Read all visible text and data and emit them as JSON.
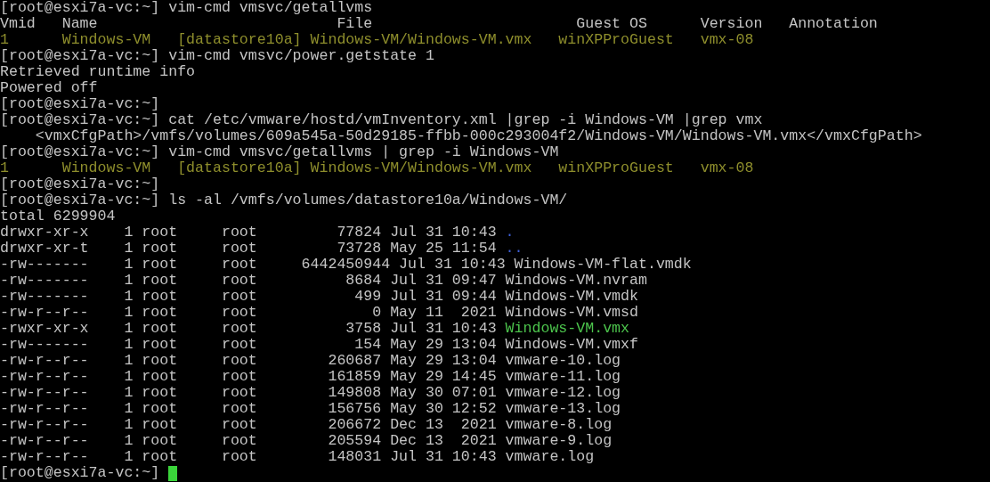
{
  "terminal": {
    "lines": [
      {
        "segments": [
          {
            "text": "[root@esxi7a-vc:~] vim-cmd vmsvc/getallvms",
            "kind": "text"
          }
        ]
      },
      {
        "segments": [
          {
            "text": "Vmid   Name                           File                       Guest OS      Version   Annotation",
            "kind": "text"
          }
        ]
      },
      {
        "segments": [
          {
            "text": "1      Windows-VM   [datastore10a] Windows-VM/Windows-VM.vmx   winXPProGuest   vmx-08",
            "kind": "vm-row"
          }
        ]
      },
      {
        "segments": [
          {
            "text": "[root@esxi7a-vc:~] vim-cmd vmsvc/power.getstate 1",
            "kind": "text"
          }
        ]
      },
      {
        "segments": [
          {
            "text": "Retrieved runtime info",
            "kind": "text"
          }
        ]
      },
      {
        "segments": [
          {
            "text": "Powered off",
            "kind": "text"
          }
        ]
      },
      {
        "segments": [
          {
            "text": "[root@esxi7a-vc:~]",
            "kind": "text"
          }
        ]
      },
      {
        "segments": [
          {
            "text": "[root@esxi7a-vc:~] cat /etc/vmware/hostd/vmInventory.xml |grep -i Windows-VM |grep vmx",
            "kind": "text"
          }
        ]
      },
      {
        "segments": [
          {
            "text": "    <vmxCfgPath>/vmfs/volumes/609a545a-50d29185-ffbb-000c293004f2/Windows-VM/Windows-VM.vmx</vmxCfgPath>",
            "kind": "text"
          }
        ]
      },
      {
        "segments": [
          {
            "text": "[root@esxi7a-vc:~] vim-cmd vmsvc/getallvms | grep -i Windows-VM",
            "kind": "text"
          }
        ]
      },
      {
        "segments": [
          {
            "text": "1      Windows-VM   [datastore10a] Windows-VM/Windows-VM.vmx   winXPProGuest   vmx-08",
            "kind": "vm-row"
          }
        ]
      },
      {
        "segments": [
          {
            "text": "[root@esxi7a-vc:~]",
            "kind": "text"
          }
        ]
      },
      {
        "segments": [
          {
            "text": "[root@esxi7a-vc:~] ls -al /vmfs/volumes/datastore10a/Windows-VM/",
            "kind": "text"
          }
        ]
      },
      {
        "segments": [
          {
            "text": "total 6299904",
            "kind": "text"
          }
        ]
      },
      {
        "segments": [
          {
            "text": "drwxr-xr-x    1 root     root         77824 Jul 31 10:43",
            "kind": "text"
          },
          {
            "text": ".",
            "kind": "directory"
          }
        ]
      },
      {
        "segments": [
          {
            "text": "drwxr-xr-t    1 root     root         73728 May 25 11:54",
            "kind": "text"
          },
          {
            "text": "..",
            "kind": "directory"
          }
        ]
      },
      {
        "segments": [
          {
            "text": "-rw-------    1 root     root     6442450944 Jul 31 10:43",
            "kind": "text"
          },
          {
            "text": "Windows-VM-flat.vmdk",
            "kind": "file"
          }
        ]
      },
      {
        "segments": [
          {
            "text": "-rw-------    1 root     root          8684 Jul 31 09:47",
            "kind": "text"
          },
          {
            "text": "Windows-VM.nvram",
            "kind": "file"
          }
        ]
      },
      {
        "segments": [
          {
            "text": "-rw-------    1 root     root           499 Jul 31 09:44",
            "kind": "text"
          },
          {
            "text": "Windows-VM.vmdk",
            "kind": "file"
          }
        ]
      },
      {
        "segments": [
          {
            "text": "-rw-r--r--    1 root     root             0 May 11  2021",
            "kind": "text"
          },
          {
            "text": "Windows-VM.vmsd",
            "kind": "file"
          }
        ]
      },
      {
        "segments": [
          {
            "text": "-rwxr-xr-x    1 root     root          3758 Jul 31 10:43",
            "kind": "text"
          },
          {
            "text": "Windows-VM.vmx",
            "kind": "executable"
          }
        ]
      },
      {
        "segments": [
          {
            "text": "-rw-------    1 root     root           154 May 29 13:04",
            "kind": "text"
          },
          {
            "text": "Windows-VM.vmxf",
            "kind": "file"
          }
        ]
      },
      {
        "segments": [
          {
            "text": "-rw-r--r--    1 root     root        260687 May 29 13:04",
            "kind": "text"
          },
          {
            "text": "vmware-10.log",
            "kind": "file"
          }
        ]
      },
      {
        "segments": [
          {
            "text": "-rw-r--r--    1 root     root        161859 May 29 14:45",
            "kind": "text"
          },
          {
            "text": "vmware-11.log",
            "kind": "file"
          }
        ]
      },
      {
        "segments": [
          {
            "text": "-rw-r--r--    1 root     root        149808 May 30 07:01",
            "kind": "text"
          },
          {
            "text": "vmware-12.log",
            "kind": "file"
          }
        ]
      },
      {
        "segments": [
          {
            "text": "-rw-r--r--    1 root     root        156756 May 30 12:52",
            "kind": "text"
          },
          {
            "text": "vmware-13.log",
            "kind": "file"
          }
        ]
      },
      {
        "segments": [
          {
            "text": "-rw-r--r--    1 root     root        206672 Dec 13  2021",
            "kind": "text"
          },
          {
            "text": "vmware-8.log",
            "kind": "file"
          }
        ]
      },
      {
        "segments": [
          {
            "text": "-rw-r--r--    1 root     root        205594 Dec 13  2021",
            "kind": "text"
          },
          {
            "text": "vmware-9.log",
            "kind": "file"
          }
        ]
      },
      {
        "segments": [
          {
            "text": "-rw-r--r--    1 root     root        148031 Jul 31 10:43",
            "kind": "text"
          },
          {
            "text": "vmware.log",
            "kind": "file"
          }
        ]
      },
      {
        "segments": [
          {
            "text": "[root@esxi7a-vc:~]",
            "kind": "text"
          }
        ],
        "cursor": true
      }
    ]
  }
}
